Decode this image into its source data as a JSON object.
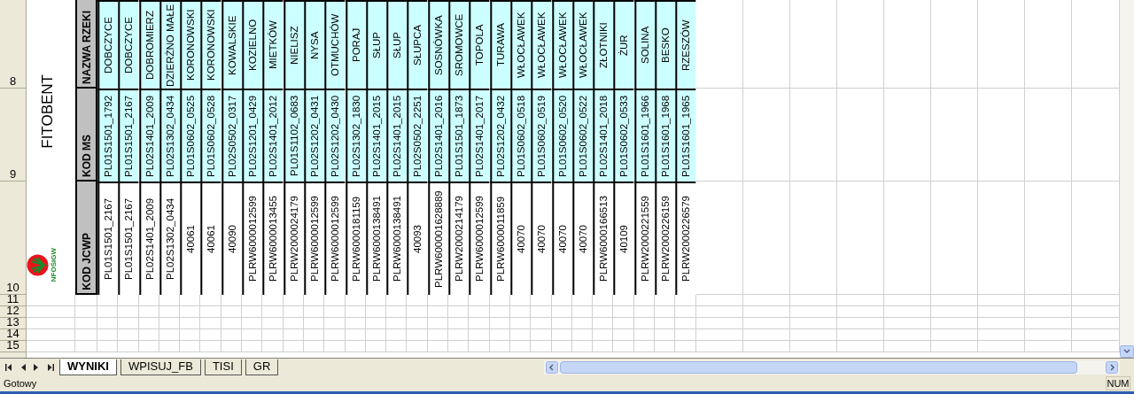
{
  "title": "FITOBENT",
  "logo": {
    "text": "NFOŚiGW"
  },
  "row_numbers": [
    "8",
    "9",
    "10",
    "11",
    "12",
    "13",
    "14",
    "15"
  ],
  "headers": [
    "NAZWA RZEKI",
    "KOD MS",
    "KOD JCWP"
  ],
  "records": [
    {
      "name": "DOBCZYCE",
      "ms": "PL01S1501_1792",
      "jcwp": "PL01S1501_2167"
    },
    {
      "name": "DOBCZYCE",
      "ms": "PL01S1501_2167",
      "jcwp": "PL01S1501_2167"
    },
    {
      "name": "DOBROMIERZ",
      "ms": "PL02S1401_2009",
      "jcwp": "PL02S1401_2009"
    },
    {
      "name": "DZIERŻNO MAŁE",
      "ms": "PL02S1302_0434",
      "jcwp": "PL02S1302_0434"
    },
    {
      "name": "KORONOWSKI",
      "ms": "PL01S0602_0525",
      "jcwp": "40061"
    },
    {
      "name": "KORONOWSKI",
      "ms": "PL01S0602_0528",
      "jcwp": "40061"
    },
    {
      "name": "KOWALSKIE",
      "ms": "PL02S0502_0317",
      "jcwp": "40090"
    },
    {
      "name": "KOZIELNO",
      "ms": "PL02S1201_0429",
      "jcwp": "PLRW6000012599"
    },
    {
      "name": "MIETKÓW",
      "ms": "PL02S1401_2012",
      "jcwp": "PLRW6000013455"
    },
    {
      "name": "NIELISZ",
      "ms": "PL01S1102_0683",
      "jcwp": "PLRW2000024179"
    },
    {
      "name": "NYSA",
      "ms": "PL02S1202_0431",
      "jcwp": "PLRW6000012599"
    },
    {
      "name": "OTMUCHÓW",
      "ms": "PL02S1202_0430",
      "jcwp": "PLRW6000012599"
    },
    {
      "name": "PORAJ",
      "ms": "PL02S1302_1830",
      "jcwp": "PLRW6000181159"
    },
    {
      "name": "SŁUP",
      "ms": "PL02S1401_2015",
      "jcwp": "PLRW6000138491"
    },
    {
      "name": "SŁUP",
      "ms": "PL02S1401_2015",
      "jcwp": "PLRW6000138491"
    },
    {
      "name": "SŁUPCA",
      "ms": "PL02S0502_2251",
      "jcwp": "40093"
    },
    {
      "name": "SOSNÓWKA",
      "ms": "PL02S1401_2016",
      "jcwp": "PLRW600001628889"
    },
    {
      "name": "SROMOWCE",
      "ms": "PL01S1501_1873",
      "jcwp": "PLRW2000214179"
    },
    {
      "name": "TOPOLA",
      "ms": "PL02S1401_2017",
      "jcwp": "PLRW6000012599"
    },
    {
      "name": "TURAWA",
      "ms": "PL02S1202_0432",
      "jcwp": "PLRW6000011859"
    },
    {
      "name": "WŁOCŁAWEK",
      "ms": "PL01S0602_0518",
      "jcwp": "40070"
    },
    {
      "name": "WŁOCŁAWEK",
      "ms": "PL01S0602_0519",
      "jcwp": "40070"
    },
    {
      "name": "WŁOCŁAWEK",
      "ms": "PL01S0602_0520",
      "jcwp": "40070"
    },
    {
      "name": "WŁOCŁAWEK",
      "ms": "PL01S0602_0522",
      "jcwp": "40070"
    },
    {
      "name": "ZŁOTNIKI",
      "ms": "PL02S1401_2018",
      "jcwp": "PLRW6000166513"
    },
    {
      "name": "ŻUR",
      "ms": "PL01S0602_0533",
      "jcwp": "40109"
    },
    {
      "name": "SOLINA",
      "ms": "PL01S1601_1966",
      "jcwp": "PLRW2000221559"
    },
    {
      "name": "BESKO",
      "ms": "PL01S1601_1968",
      "jcwp": "PLRW2000226159"
    },
    {
      "name": "RZESZÓW",
      "ms": "PL01S1601_1965",
      "jcwp": "PLRW2000226579"
    }
  ],
  "sheet_tabs": [
    {
      "label": "WYNIKI",
      "selected": true
    },
    {
      "label": "WPISUJ_FB",
      "selected": false
    },
    {
      "label": "TISI",
      "selected": false
    },
    {
      "label": "GR",
      "selected": false
    }
  ],
  "status_bar": {
    "text": "Gotowy",
    "indicator": "NUM"
  }
}
